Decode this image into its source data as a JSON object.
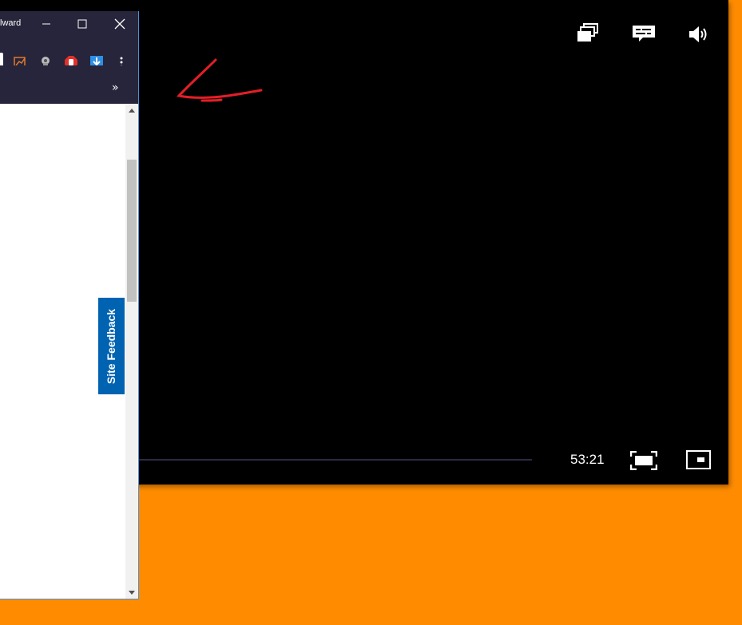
{
  "player": {
    "time_display": "53:21",
    "icons": {
      "playlist": "stacked-windows-icon",
      "captions": "captions-icon",
      "volume": "speaker-icon",
      "fullscreen": "fullscreen-icon",
      "miniplayer": "mini-player-icon"
    },
    "annotation": "red-arrow-pointing-left"
  },
  "browser": {
    "title_fragment": "lward",
    "window_buttons": [
      "minimize",
      "maximize",
      "close"
    ],
    "extensions": [
      "chart-extension",
      "lighthouse-extension",
      "adblock-extension",
      "download-extension"
    ],
    "menu": "more-menu",
    "bookmarks_overflow": "»",
    "feedback_tab": "Site Feedback"
  },
  "colors": {
    "desktop": "#ff8c00",
    "browser_chrome": "#26253b",
    "feedback": "#0063b1"
  }
}
